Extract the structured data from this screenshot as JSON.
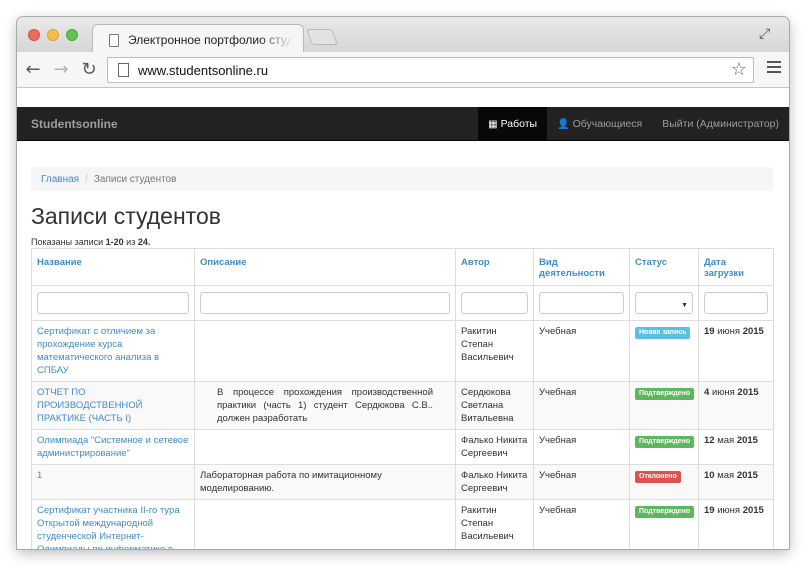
{
  "browser": {
    "tab_title": "Электронное портфолио студ",
    "url": "www.studentsonline.ru"
  },
  "navbar": {
    "brand": "Studentsonline",
    "items": [
      {
        "label": "Работы",
        "icon": "table-icon",
        "active": true
      },
      {
        "label": "Обучающиеся",
        "icon": "user-icon",
        "active": false
      },
      {
        "label": "Выйти (Администратор)",
        "icon": "",
        "active": false
      }
    ]
  },
  "breadcrumb": {
    "home": "Главная",
    "separator": "/",
    "current": "Записи студентов"
  },
  "page": {
    "title": "Записи студентов",
    "summary_prefix": "Показаны записи ",
    "summary_range": "1-20",
    "summary_mid": " из ",
    "summary_total": "24."
  },
  "table": {
    "columns": [
      "Название",
      "Описание",
      "Автор",
      "Вид деятельности",
      "Статус",
      "Дата загрузки"
    ],
    "rows": [
      {
        "title": "Сертификат с отличием за прохождение курса математического анализа в СПБАУ",
        "description": "",
        "author": "Ракитин Степан Васильевич",
        "activity": "Учебная",
        "status": "Новая запись",
        "status_color": "#5bc0de",
        "date_day": "19",
        "date_month": "июня",
        "date_year": "2015"
      },
      {
        "title": "ОТЧЕТ ПО ПРОИЗВОДСТВЕННОЙ ПРАКТИКЕ (ЧАСТЬ I)",
        "description": "В процессе прохождения производственной практики (часть 1) студент Сердюкова С.В.. должен разработать",
        "author": "Сердюкова Светлана Витальевна",
        "activity": "Учебная",
        "status": "Подтверждено",
        "status_color": "#5cb85c",
        "date_day": "4",
        "date_month": "июня",
        "date_year": "2015"
      },
      {
        "title": "Олимпиада \"Системное и сетевое администрирование\"",
        "description": "",
        "author": "Фалько Никита Сергеевич",
        "activity": "Учебная",
        "status": "Подтверждено",
        "status_color": "#5cb85c",
        "date_day": "12",
        "date_month": "мая",
        "date_year": "2015"
      },
      {
        "title": "1",
        "description": "Лабораторная работа по имитационному моделированию.",
        "author": "Фалько Никита Сергеевич",
        "activity": "Учебная",
        "status": "Отклонено",
        "status_color": "#d9534f",
        "date_day": "10",
        "date_month": "мая",
        "date_year": "2015"
      },
      {
        "title": "Сертификат участника II-го тура Открытой международной студенческой Интернет-Олимпиады по информатике в",
        "description": "",
        "author": "Ракитин Степан Васильевич",
        "activity": "Учебная",
        "status": "Подтверждено",
        "status_color": "#5cb85c",
        "date_day": "19",
        "date_month": "июня",
        "date_year": "2015"
      }
    ]
  }
}
